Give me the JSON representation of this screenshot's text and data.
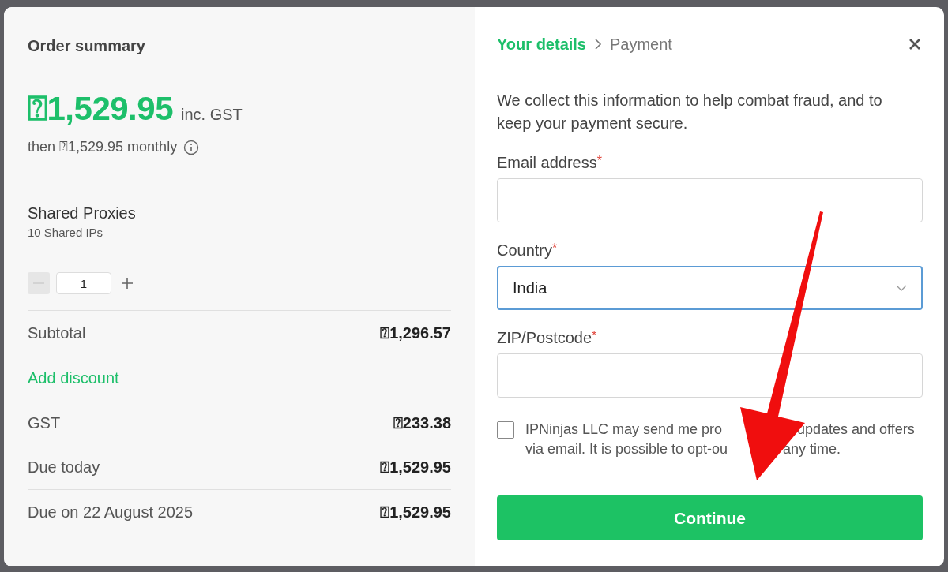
{
  "summary": {
    "title": "Order summary",
    "price": "⍰1,529.95",
    "price_note": "inc. GST",
    "recurring": "then ⍰1,529.95 monthly",
    "product": {
      "name": "Shared Proxies",
      "detail": "10 Shared IPs"
    },
    "quantity": {
      "value": "1",
      "minus_disabled": true
    },
    "lines": [
      {
        "kind": "row",
        "label": "Subtotal",
        "amount": "⍰1,296.57",
        "divider_above": true
      },
      {
        "kind": "link",
        "label": "Add discount"
      },
      {
        "kind": "row",
        "label": "GST",
        "amount": "⍰233.38",
        "divider_above": false
      },
      {
        "kind": "row",
        "label": "Due today",
        "amount": "⍰1,529.95",
        "divider_above": false
      },
      {
        "kind": "row",
        "label": "Due on 22 August 2025",
        "amount": "⍰1,529.95",
        "divider_above": true
      }
    ]
  },
  "details": {
    "steps": [
      {
        "label": "Your details",
        "selected": true
      },
      {
        "label": "Payment",
        "selected": false
      }
    ],
    "intro": "We collect this information to help combat fraud, and to keep your payment secure.",
    "fields": [
      {
        "kind": "text",
        "label": "Email address",
        "marker": "*",
        "focused": false
      },
      {
        "kind": "select",
        "label": "Country",
        "marker": "*",
        "value": "India",
        "focused": true
      },
      {
        "kind": "text",
        "label": "ZIP/Postcode",
        "marker": "*",
        "focused": false
      }
    ],
    "consent": {
      "lines": [
        [
          "IPNinjas LLC may send me pro",
          "updates and offers"
        ],
        [
          "via email. It is possible to opt-ou",
          "any time."
        ]
      ],
      "checked": false
    },
    "submit": "Continue"
  }
}
